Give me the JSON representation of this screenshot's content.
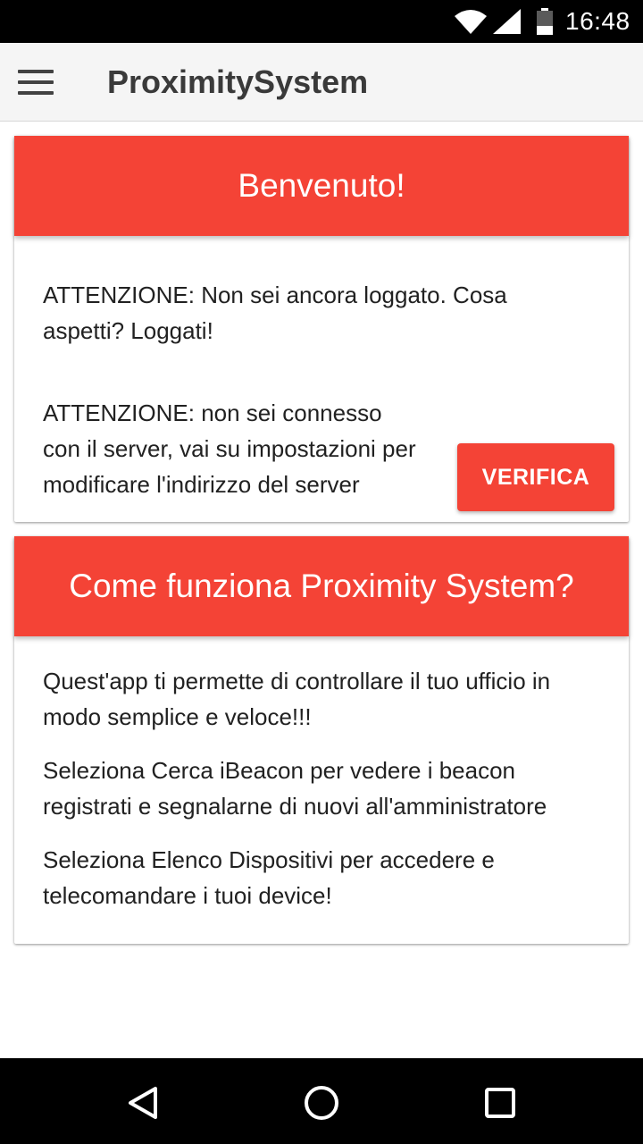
{
  "status_bar": {
    "time": "16:48",
    "icons": [
      "wifi-icon",
      "signal-icon",
      "battery-icon"
    ]
  },
  "app_bar": {
    "title": "ProximitySystem",
    "menu_icon": "menu-icon"
  },
  "welcome_card": {
    "title": "Benvenuto!",
    "login_warning": [
      "ATTENZIONE: Non sei ancora loggato. Cosa",
      "aspetti? Loggati!"
    ],
    "server_warning": [
      "ATTENZIONE: non sei connesso",
      "con il server, vai su impostazioni per",
      "modificare l'indirizzo del server"
    ],
    "verify_button": "VERIFICA"
  },
  "info_card": {
    "title": "Come funziona Proximity System?",
    "paragraphs": [
      [
        "Quest'app ti permette di controllare il tuo ufficio in",
        "modo semplice e veloce!!!"
      ],
      [
        "Seleziona Cerca iBeacon per vedere i beacon",
        "registrati e segnalarne di nuovi all'amministratore"
      ],
      [
        "Seleziona Elenco Dispositivi per accedere e",
        "telecomandare i tuoi device!"
      ]
    ]
  },
  "nav_bar": {
    "buttons": [
      "back-icon",
      "home-icon",
      "recents-icon"
    ]
  },
  "colors": {
    "accent": "#f44336",
    "app_bar": "#f5f5f5",
    "system_bars": "#000000"
  }
}
